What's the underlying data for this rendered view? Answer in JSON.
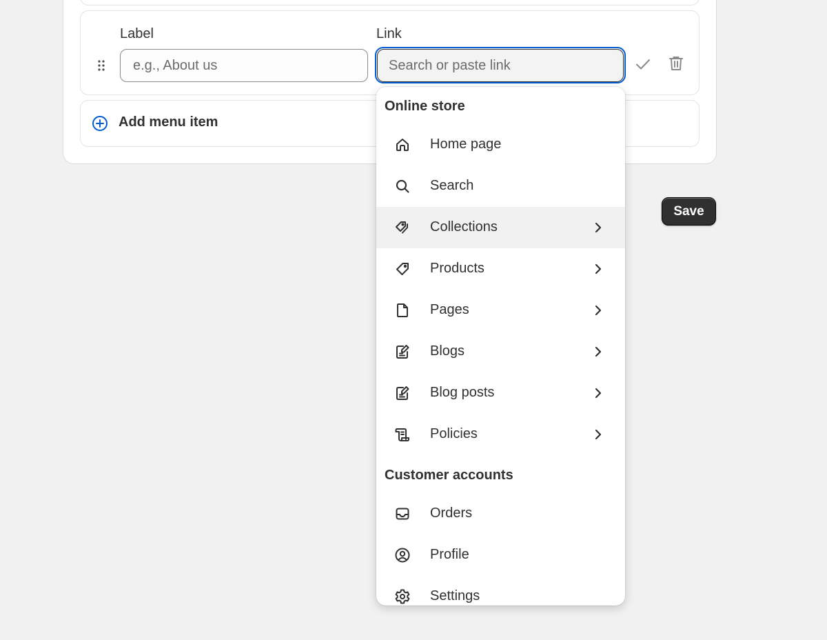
{
  "menu_editor": {
    "label_field": {
      "label": "Label",
      "placeholder": "e.g., About us",
      "value": ""
    },
    "link_field": {
      "label": "Link",
      "placeholder": "Search or paste link",
      "value": ""
    },
    "add_item_label": "Add menu item"
  },
  "save_label": "Save",
  "link_dropdown": {
    "sections": [
      {
        "title": "Online store",
        "items": [
          {
            "label": "Home page",
            "icon": "home-icon",
            "has_submenu": false
          },
          {
            "label": "Search",
            "icon": "search-icon",
            "has_submenu": false
          },
          {
            "label": "Collections",
            "icon": "tags-icon",
            "has_submenu": true,
            "highlighted": true
          },
          {
            "label": "Products",
            "icon": "tag-icon",
            "has_submenu": true
          },
          {
            "label": "Pages",
            "icon": "page-icon",
            "has_submenu": true
          },
          {
            "label": "Blogs",
            "icon": "blog-icon",
            "has_submenu": true
          },
          {
            "label": "Blog posts",
            "icon": "blog-post-icon",
            "has_submenu": true
          },
          {
            "label": "Policies",
            "icon": "policy-scroll-icon",
            "has_submenu": true
          }
        ]
      },
      {
        "title": "Customer accounts",
        "items": [
          {
            "label": "Orders",
            "icon": "inbox-icon",
            "has_submenu": false
          },
          {
            "label": "Profile",
            "icon": "profile-icon",
            "has_submenu": false
          },
          {
            "label": "Settings",
            "icon": "gear-icon",
            "has_submenu": false
          }
        ]
      }
    ]
  },
  "colors": {
    "focus_ring": "#005bd3",
    "add_icon": "#005bd3",
    "save_button_bg": "#303030",
    "highlight_bg": "#f1f1f1",
    "page_bg": "#f1f1f1"
  }
}
